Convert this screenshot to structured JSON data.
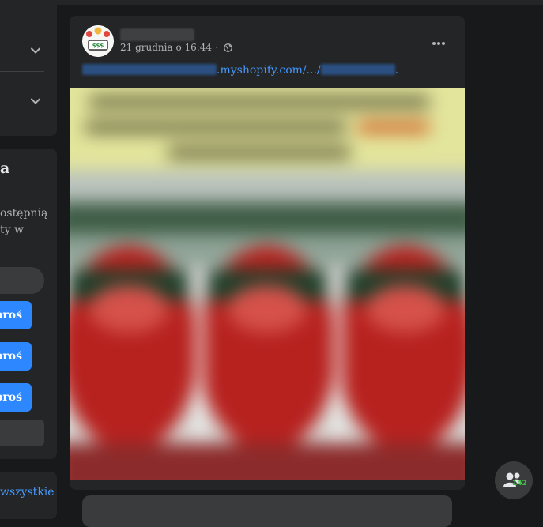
{
  "left_column": {
    "groups_title": "a",
    "invite_text": "ostępnią\nty w",
    "invite_buttons": [
      "proś",
      "proś",
      "proś"
    ],
    "see_all_label": "wszystkie"
  },
  "post": {
    "author_name": "",
    "timestamp": "21 grudnia o 16:44",
    "separator": "·",
    "privacy_icon": "globe-icon",
    "link_domain": ".myshopify.com/.../",
    "link_end": "."
  },
  "contacts_fab": {
    "icon": "people-icon",
    "badge": "142"
  },
  "colors": {
    "background": "#18191a",
    "card": "#242526",
    "link": "#4599ff",
    "button": "#2d88ff",
    "badge_green": "#3fbb46"
  }
}
